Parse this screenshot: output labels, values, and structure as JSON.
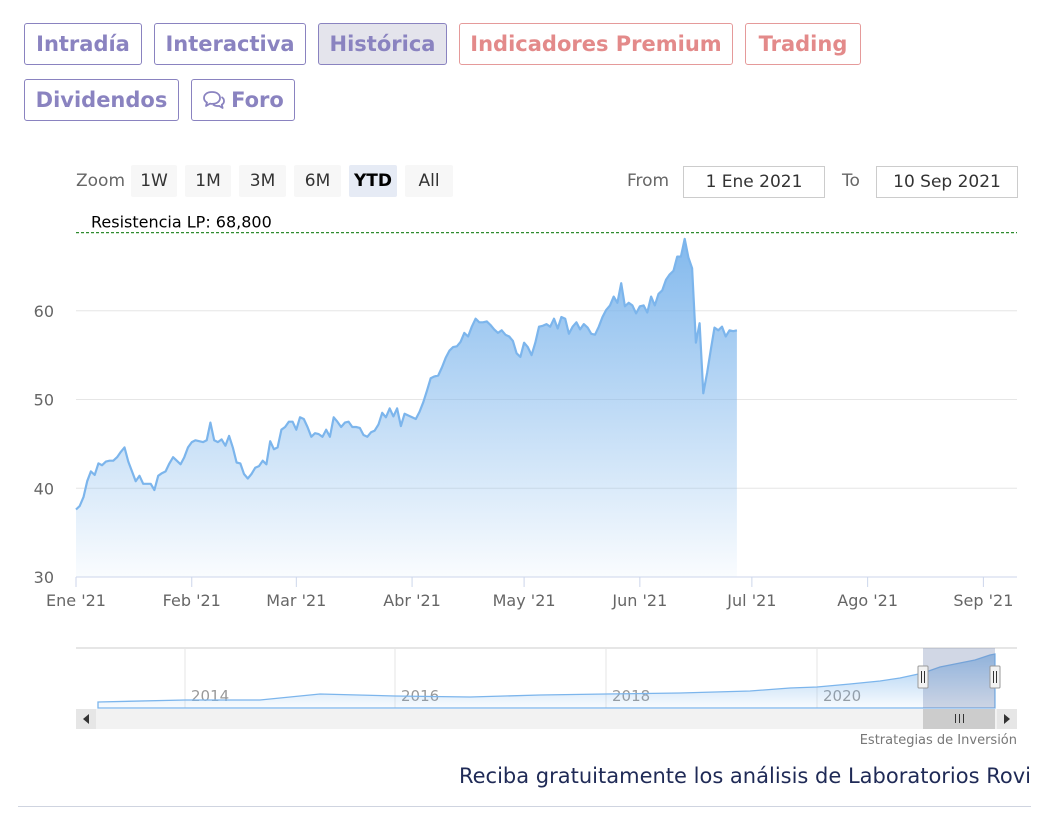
{
  "nav": {
    "tabs": [
      {
        "label": "Intradía",
        "state": "normal"
      },
      {
        "label": "Interactiva",
        "state": "normal"
      },
      {
        "label": "Histórica",
        "state": "active"
      },
      {
        "label": "Indicadores Premium",
        "state": "premium"
      },
      {
        "label": "Trading",
        "state": "premium"
      },
      {
        "label": "Dividendos",
        "state": "normal"
      },
      {
        "label": "Foro",
        "state": "normal",
        "icon": "speech-bubbles-icon"
      }
    ]
  },
  "toolbar": {
    "zoom_label": "Zoom",
    "zoom_buttons": [
      "1W",
      "1M",
      "3M",
      "6M",
      "YTD",
      "All"
    ],
    "zoom_selected": "YTD",
    "from_label": "From",
    "from_value": "1 Ene 2021",
    "to_label": "To",
    "to_value": "10 Sep 2021"
  },
  "colors": {
    "line": "#7cb5ec",
    "resistance": "#2e8b2e",
    "tab_text": "#8a83c0",
    "premium_text": "#e38a8a"
  },
  "chart_data": {
    "type": "area",
    "ylim": [
      30,
      70
    ],
    "y_ticks": [
      30,
      40,
      50,
      60
    ],
    "x_tick_labels": [
      "Ene '21",
      "Feb '21",
      "Mar '21",
      "Abr '21",
      "May '21",
      "Jun '21",
      "Jul '21",
      "Ago '21",
      "Sep '21"
    ],
    "x_range_days": [
      0,
      252
    ],
    "x_ticks_days": [
      0,
      31,
      59,
      90,
      120,
      151,
      181,
      212,
      243
    ],
    "series": [
      {
        "values": [
          [
            0,
            37.6
          ],
          [
            1,
            38
          ],
          [
            2,
            39
          ],
          [
            3,
            40.8
          ],
          [
            4,
            41.9
          ],
          [
            5,
            41.5
          ],
          [
            6,
            42.8
          ],
          [
            7,
            42.6
          ],
          [
            8,
            43
          ],
          [
            9,
            43.1
          ],
          [
            10,
            43.1
          ],
          [
            11,
            43.5
          ],
          [
            12,
            44.1
          ],
          [
            13,
            44.6
          ],
          [
            14,
            43
          ],
          [
            15,
            41.9
          ],
          [
            16,
            40.8
          ],
          [
            17,
            41.4
          ],
          [
            18,
            40.5
          ],
          [
            19,
            40.5
          ],
          [
            20,
            40.5
          ],
          [
            21,
            39.8
          ],
          [
            22,
            41.4
          ],
          [
            23,
            41.7
          ],
          [
            24,
            41.9
          ],
          [
            25,
            42.8
          ],
          [
            26,
            43.5
          ],
          [
            27,
            43.1
          ],
          [
            28,
            42.7
          ],
          [
            29,
            43.5
          ],
          [
            30,
            44.6
          ],
          [
            31,
            45.2
          ],
          [
            32,
            45.4
          ],
          [
            33,
            45.3
          ],
          [
            34,
            45.2
          ],
          [
            35,
            45.4
          ],
          [
            36,
            47.4
          ],
          [
            37,
            45.4
          ],
          [
            38,
            45.2
          ],
          [
            39,
            45.5
          ],
          [
            40,
            44.8
          ],
          [
            41,
            45.9
          ],
          [
            42,
            44.6
          ],
          [
            43,
            42.9
          ],
          [
            44,
            42.8
          ],
          [
            45,
            41.6
          ],
          [
            46,
            41.1
          ],
          [
            47,
            41.6
          ],
          [
            48,
            42.3
          ],
          [
            49,
            42.5
          ],
          [
            50,
            43.1
          ],
          [
            51,
            42.7
          ],
          [
            52,
            45.3
          ],
          [
            53,
            44.4
          ],
          [
            54,
            44.6
          ],
          [
            55,
            46.6
          ],
          [
            56,
            46.9
          ],
          [
            57,
            47.5
          ],
          [
            58,
            47.5
          ],
          [
            59,
            46.6
          ],
          [
            60,
            48
          ],
          [
            61,
            47.8
          ],
          [
            62,
            46.9
          ],
          [
            63,
            45.8
          ],
          [
            64,
            46.2
          ],
          [
            65,
            46.1
          ],
          [
            66,
            45.8
          ],
          [
            67,
            46.6
          ],
          [
            68,
            45.8
          ],
          [
            69,
            48
          ],
          [
            70,
            47.5
          ],
          [
            71,
            46.9
          ],
          [
            72,
            47.4
          ],
          [
            73,
            47.5
          ],
          [
            74,
            46.9
          ],
          [
            75,
            46.9
          ],
          [
            76,
            46.8
          ],
          [
            77,
            46
          ],
          [
            78,
            45.8
          ],
          [
            79,
            46.3
          ],
          [
            80,
            46.5
          ],
          [
            81,
            47.2
          ],
          [
            82,
            48.5
          ],
          [
            83,
            48
          ],
          [
            84,
            49
          ],
          [
            85,
            48.1
          ],
          [
            86,
            49
          ],
          [
            87,
            47
          ],
          [
            88,
            48.4
          ],
          [
            89,
            48.2
          ],
          [
            90,
            48
          ],
          [
            91,
            47.8
          ],
          [
            92,
            48.6
          ],
          [
            93,
            49.7
          ],
          [
            94,
            51
          ],
          [
            95,
            52.4
          ],
          [
            96,
            52.6
          ],
          [
            97,
            52.7
          ],
          [
            98,
            53.6
          ],
          [
            99,
            54.7
          ],
          [
            100,
            55.5
          ],
          [
            101,
            55.9
          ],
          [
            102,
            56
          ],
          [
            103,
            56.5
          ],
          [
            104,
            57.5
          ],
          [
            105,
            57.1
          ],
          [
            106,
            58.2
          ],
          [
            107,
            59.1
          ],
          [
            108,
            58.7
          ],
          [
            109,
            58.7
          ],
          [
            110,
            58.8
          ],
          [
            111,
            58.4
          ],
          [
            112,
            57.9
          ],
          [
            113,
            57.5
          ],
          [
            114,
            57.8
          ],
          [
            115,
            57.3
          ],
          [
            116,
            57.1
          ],
          [
            117,
            56.6
          ],
          [
            118,
            55.2
          ],
          [
            119,
            54.8
          ],
          [
            120,
            56.4
          ],
          [
            121,
            55.9
          ],
          [
            122,
            55
          ],
          [
            123,
            56.4
          ],
          [
            124,
            58.2
          ],
          [
            125,
            58.3
          ],
          [
            126,
            58.5
          ],
          [
            127,
            58.2
          ],
          [
            128,
            59.1
          ],
          [
            129,
            58
          ],
          [
            130,
            59.3
          ],
          [
            131,
            59.1
          ],
          [
            132,
            57.4
          ],
          [
            133,
            58.2
          ],
          [
            134,
            58.7
          ],
          [
            135,
            57.9
          ],
          [
            136,
            58.5
          ],
          [
            137,
            58.1
          ],
          [
            138,
            57.4
          ],
          [
            139,
            57.3
          ],
          [
            140,
            58.2
          ],
          [
            141,
            59.3
          ],
          [
            142,
            60.1
          ],
          [
            143,
            60.6
          ],
          [
            144,
            61.6
          ],
          [
            145,
            60.9
          ],
          [
            146,
            63.1
          ],
          [
            147,
            60.5
          ],
          [
            148,
            60.9
          ],
          [
            149,
            60.6
          ],
          [
            150,
            59.7
          ],
          [
            151,
            60.5
          ],
          [
            152,
            60.6
          ],
          [
            153,
            59.8
          ],
          [
            154,
            61.6
          ],
          [
            155,
            60.6
          ],
          [
            156,
            61.9
          ],
          [
            157,
            62.3
          ],
          [
            158,
            63.5
          ],
          [
            159,
            64.1
          ],
          [
            160,
            64.5
          ],
          [
            161,
            66.1
          ],
          [
            162,
            66.1
          ],
          [
            163,
            68.1
          ],
          [
            164,
            66
          ],
          [
            165,
            64.8
          ],
          [
            166,
            56.4
          ],
          [
            167,
            58.6
          ],
          [
            168,
            50.7
          ],
          [
            169,
            53
          ],
          [
            170,
            55.6
          ],
          [
            171,
            58.1
          ],
          [
            172,
            57.8
          ],
          [
            173,
            58.2
          ],
          [
            174,
            57.1
          ],
          [
            175,
            57.8
          ],
          [
            176,
            57.7
          ],
          [
            177,
            57.8
          ]
        ]
      }
    ],
    "plot_lines": [
      {
        "value": 68.8,
        "label": "Resistencia LP: 68,800"
      }
    ],
    "navigator": {
      "x_tick_labels": [
        "2014",
        "2016",
        "2018",
        "2020"
      ],
      "credit": "Estrategias de Inversión"
    }
  },
  "footer": {
    "text": "Reciba gratuitamente los análisis de Laboratorios Rovi"
  }
}
